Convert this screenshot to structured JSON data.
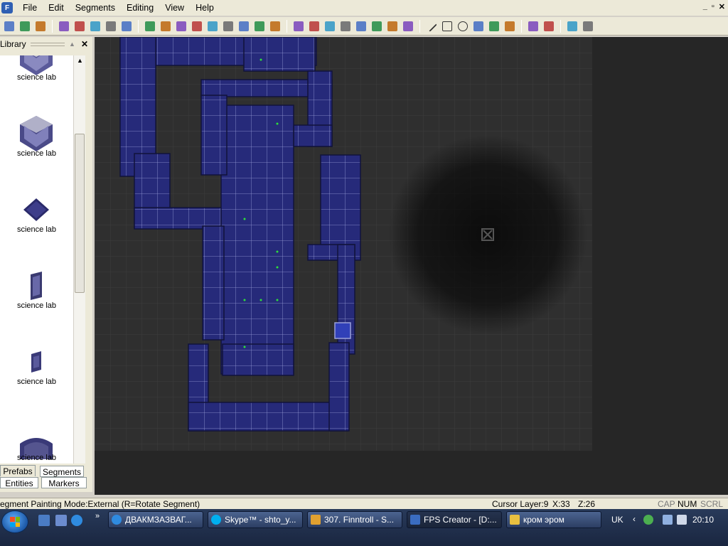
{
  "menu": [
    "File",
    "Edit",
    "Segments",
    "Editing",
    "View",
    "Help"
  ],
  "window_controls": [
    "_",
    "▫",
    "✕"
  ],
  "toolbar_icons": [
    "new-icon",
    "open-icon",
    "save-icon",
    "|",
    "cut-icon",
    "copy-icon",
    "paste-icon",
    "undo-icon",
    "redo-icon",
    "|",
    "zoom-in-icon",
    "zoom-out-icon",
    "fit-view-icon",
    "zoom-extents-icon",
    "layers-icon",
    "layer-up-icon",
    "layer-down-icon",
    "map-view-icon",
    "find-icon",
    "|",
    "paint-icon",
    "eraser-icon",
    "stamp-icon",
    "stamp-multi-icon",
    "brush-icon",
    "brush-fill-icon",
    "select-icon",
    "rotate-icon",
    "|",
    "line-icon",
    "rect-icon",
    "circle-icon",
    "fill-icon",
    "picker-icon",
    "pen-icon",
    "|",
    "flag-icon",
    "flags-icon",
    "|",
    "test-game-icon",
    "build-game-icon"
  ],
  "library": {
    "title": "Library",
    "items": [
      {
        "label": "science lab",
        "thumb": "corner-wall"
      },
      {
        "label": "science lab",
        "thumb": "corner-wall"
      },
      {
        "label": "science lab",
        "thumb": "floor-tile"
      },
      {
        "label": "science lab",
        "thumb": "door"
      },
      {
        "label": "science lab",
        "thumb": "small-panel"
      },
      {
        "label": "science lab",
        "thumb": "arch"
      }
    ],
    "tabs": [
      "Prefabs",
      "Segments",
      "Entities",
      "Markers"
    ]
  },
  "status": {
    "mode": "egment Painting Mode:External (R=Rotate Segment)",
    "cursor_layer": "Cursor Layer:9",
    "x": "X:33",
    "z": "Z:26",
    "locks": [
      "CAP",
      "NUM",
      "SCRL"
    ]
  },
  "taskbar": {
    "tasks": [
      {
        "label": "ДВАКМЗАЗВАГ...",
        "icon": "ie-icon"
      },
      {
        "label": "Skype™ - shto_y...",
        "icon": "skype-icon"
      },
      {
        "label": "307. Finntroll - S...",
        "icon": "winamp-icon"
      },
      {
        "label": "FPS Creator - [D:...",
        "icon": "fpsc-icon"
      },
      {
        "label": "кром эром",
        "icon": "folder-icon"
      }
    ],
    "lang": "UK",
    "clock": "20:10"
  },
  "colors": {
    "segment": "#262a7a",
    "grid": "#3a3a3a",
    "chrome": "#ece9d8"
  }
}
